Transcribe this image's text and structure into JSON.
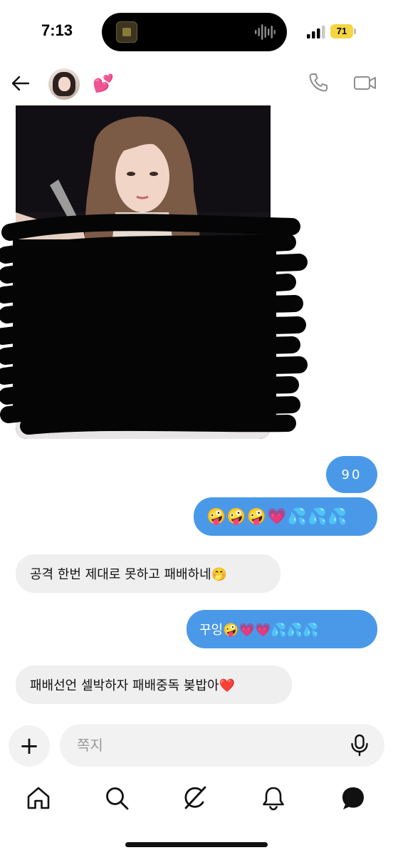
{
  "status_bar": {
    "time": "7:13",
    "battery_level": "71",
    "battery_color": "#f5d541",
    "signal_icon": "cellular-signal-icon",
    "island_icon": "audio-waveform-icon"
  },
  "header": {
    "back_icon": "arrow-left-icon",
    "name_emoji": "💕",
    "call_icon": "phone-icon",
    "video_icon": "video-camera-icon"
  },
  "messages": [
    {
      "type": "image",
      "direction": "incoming",
      "note": ""
    },
    {
      "type": "text",
      "direction": "outgoing",
      "text": "90"
    },
    {
      "type": "text",
      "direction": "outgoing",
      "text": "🤪🤪🤪💗💦💦💦"
    },
    {
      "type": "text",
      "direction": "incoming",
      "text": "공격 한번 제대로 못하고 패배하네🤭"
    },
    {
      "type": "text",
      "direction": "outgoing",
      "text": "꾸잉🤪💗💗💦💦💦"
    },
    {
      "type": "text",
      "direction": "incoming",
      "text": "패배선언 셀박하자 패배중독 봊밥아❤️"
    }
  ],
  "composer": {
    "plus_label": "+",
    "placeholder": "쪽지",
    "mic_icon": "microphone-icon"
  },
  "bottom_nav": {
    "items": [
      "home-icon",
      "search-icon",
      "grok-icon",
      "bell-icon",
      "messages-icon"
    ],
    "active": "messages-icon"
  },
  "colors": {
    "outgoing_bubble": "#4a99e9",
    "incoming_bubble": "#efefef",
    "accent": "#4a99e9"
  }
}
